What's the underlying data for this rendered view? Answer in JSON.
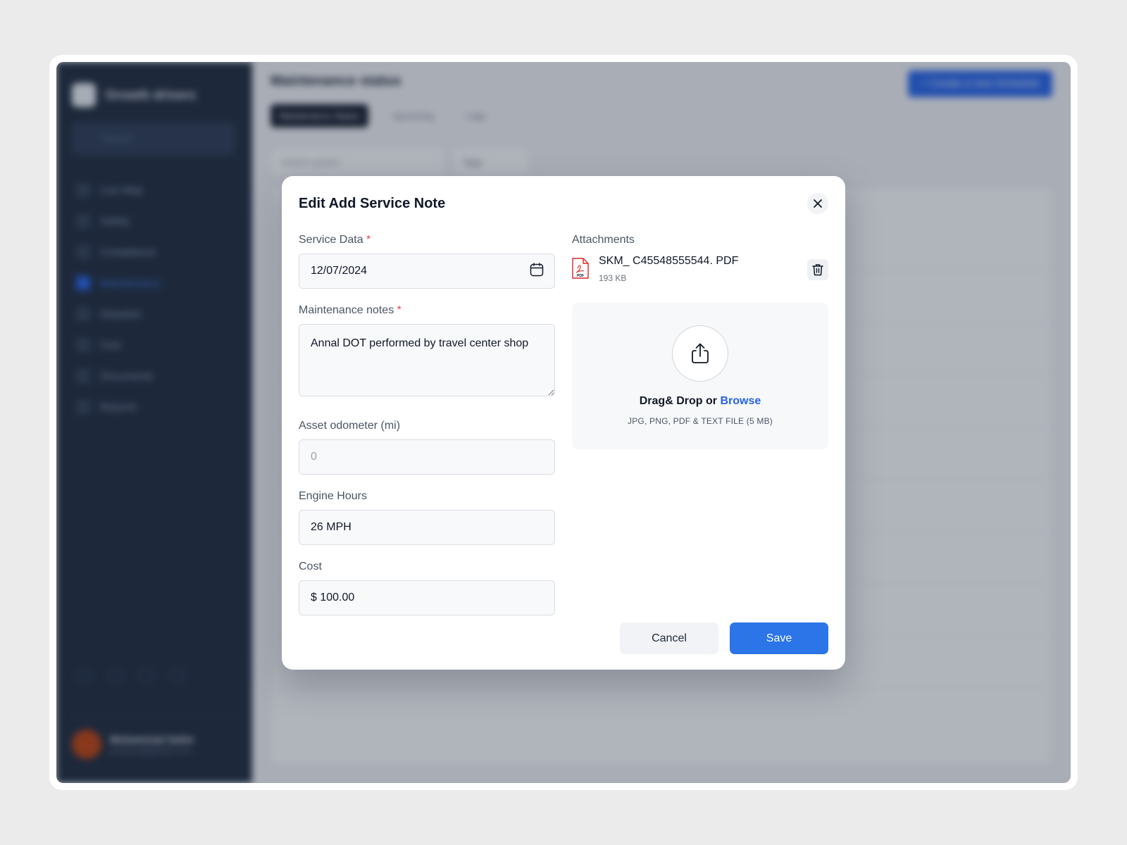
{
  "background_app": {
    "brand_name": "Growth drivers",
    "sidebar_search_placeholder": "Search",
    "nav_items": [
      {
        "label": "Live Map",
        "active": false
      },
      {
        "label": "Safety",
        "active": false
      },
      {
        "label": "Compliance",
        "active": false
      },
      {
        "label": "Maintenance",
        "active": true
      },
      {
        "label": "Dispatch",
        "active": false
      },
      {
        "label": "Fuel",
        "active": false
      },
      {
        "label": "Documents",
        "active": false
      },
      {
        "label": "Reports",
        "active": false
      }
    ],
    "user": {
      "name": "Muhammad Salim",
      "email": "product@gmail.com"
    },
    "page_title": "Maintenance status",
    "create_button": "+ Create a new Schedule",
    "tabs": [
      "Maintenance Status",
      "Upcoming",
      "Logs"
    ],
    "asset_search_placeholder": "Search assets",
    "tags_filter": "Tags"
  },
  "modal": {
    "title": "Edit Add Service Note",
    "fields": {
      "service_date": {
        "label": "Service Data",
        "required_mark": "*",
        "value": "12/07/2024"
      },
      "maintenance_notes": {
        "label": "Maintenance notes",
        "required_mark": "*",
        "value": "Annal DOT performed by travel center shop"
      },
      "odometer": {
        "label": "Asset odometer (mi)",
        "value": "",
        "placeholder": "0"
      },
      "engine_hours": {
        "label": "Engine Hours",
        "value": "26 MPH"
      },
      "cost": {
        "label": "Cost",
        "value": "$ 100.00"
      }
    },
    "attachments": {
      "label": "Attachments",
      "file": {
        "name": "SKM_ C45548555544. PDF",
        "size": "193 KB",
        "type_badge": "PDF"
      },
      "dropzone": {
        "text": "Drag& Drop or",
        "browse": "Browse",
        "hint": "JPG, PNG, PDF & TEXT FILE (5 MB)"
      }
    },
    "buttons": {
      "cancel": "Cancel",
      "save": "Save"
    }
  },
  "colors": {
    "primary": "#2b75e8",
    "required": "#ef4444",
    "sidebar": "#1e293b",
    "pdf_red": "#dc2626"
  },
  "icons": [
    "calendar-icon",
    "close-icon",
    "pdf-file-icon",
    "trash-icon",
    "upload-icon"
  ]
}
